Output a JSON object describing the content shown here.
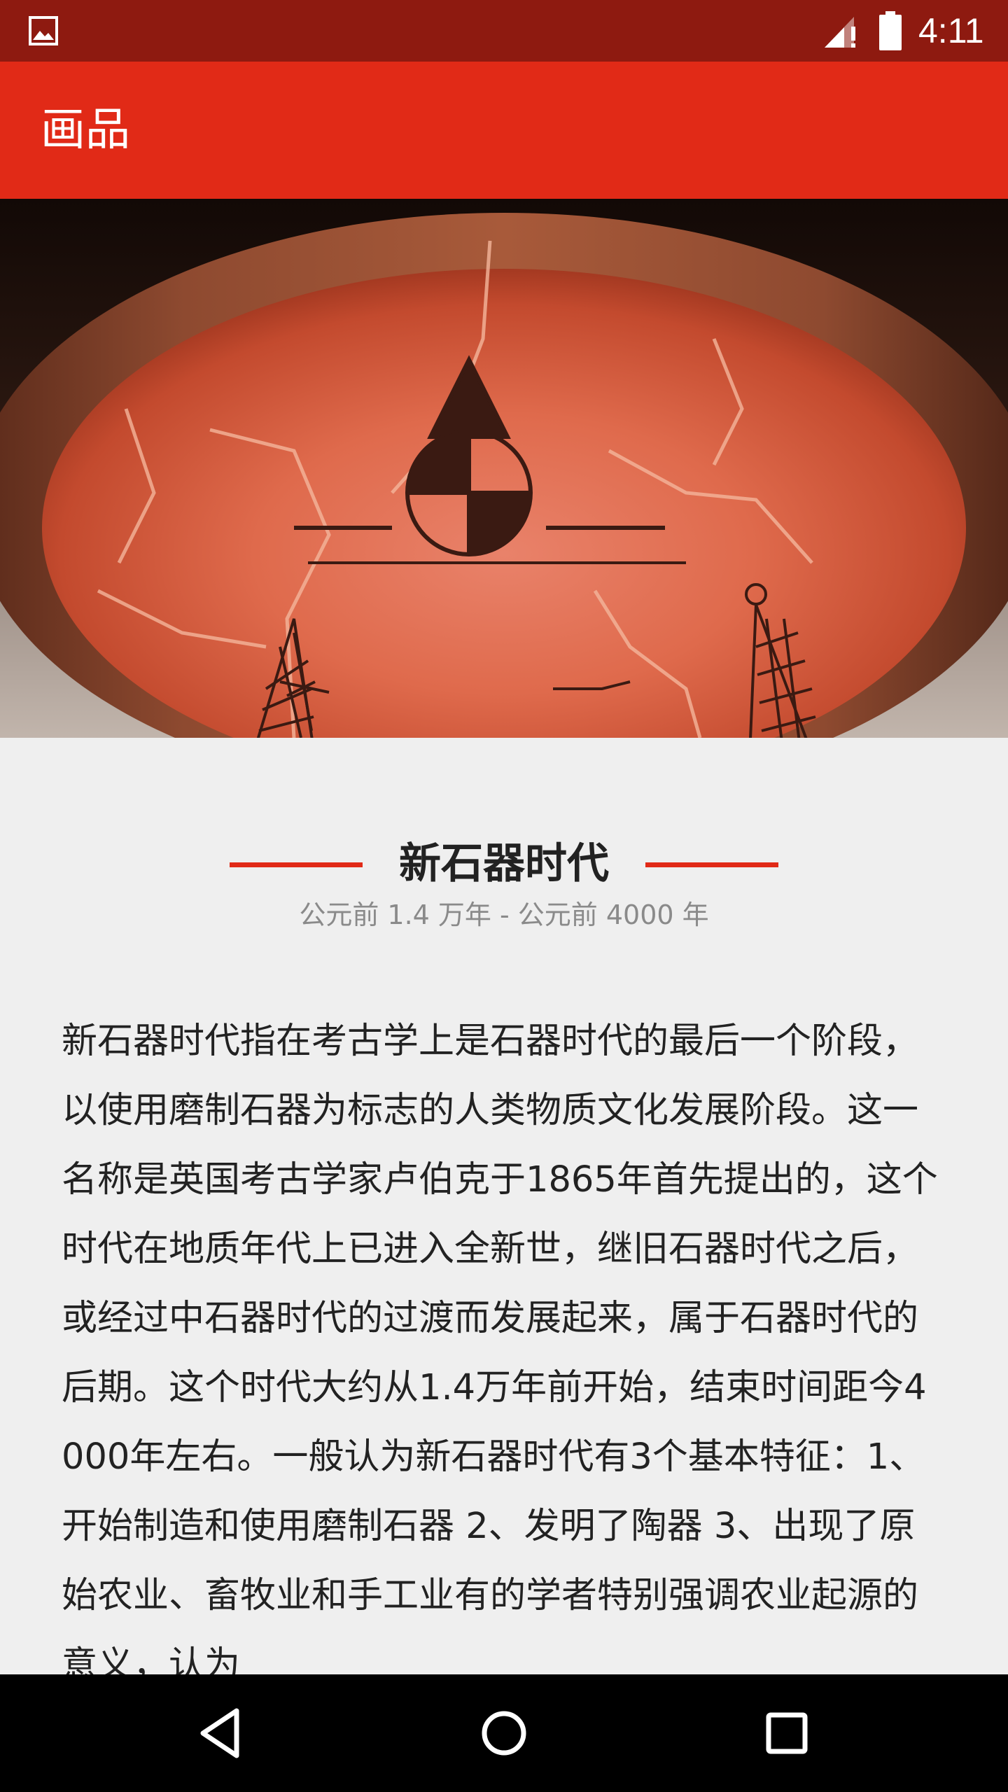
{
  "status_bar": {
    "time": "4:11",
    "icons": [
      "gallery-icon",
      "signal-icon",
      "battery-icon"
    ]
  },
  "app_bar": {
    "title": "画品"
  },
  "hero": {
    "image": "painted-pottery-bowl"
  },
  "article": {
    "title": "新石器时代",
    "period": "公元前 1.4 万年 - 公元前 4000 年",
    "body": "新石器时代指在考古学上是石器时代的最后一个阶段，以使用磨制石器为标志的人类物质文化发展阶段。这一名称是英国考古学家卢伯克于1865年首先提出的，这个时代在地质年代上已进入全新世，继旧石器时代之后，或经过中石器时代的过渡而发展起来，属于石器时代的后期。这个时代大约从1.4万年前开始，结束时间距今4000年左右。一般认为新石器时代有3个基本特征：1、开始制造和使用磨制石器 2、发明了陶器 3、出现了原始农业、畜牧业和手工业有的学者特别强调农业起源的意义，认为"
  },
  "nav_bar": {
    "buttons": [
      "back-icon",
      "home-icon",
      "recents-icon"
    ]
  },
  "colors": {
    "status_bar": "#8e1a10",
    "app_bar": "#e12a17",
    "accent": "#e12a17",
    "background": "#efefef"
  }
}
